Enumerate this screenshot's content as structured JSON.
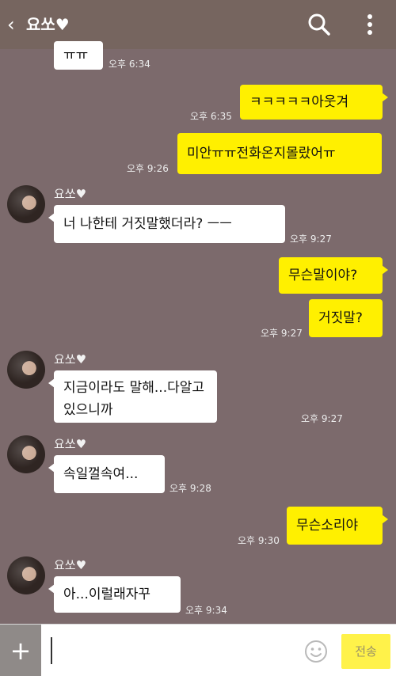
{
  "header": {
    "back_icon": "chevron-left-icon",
    "title": "요쏘♥",
    "search_icon": "search-icon",
    "more_icon": "more-vertical-icon"
  },
  "messages": [
    {
      "direction": "in",
      "text": "ㅠㅠ",
      "time": "오후 6:34"
    },
    {
      "direction": "out",
      "text": "ㅋㅋㅋㅋㅋ아웃겨",
      "time": "오후 6:35"
    },
    {
      "direction": "out",
      "text": "미안ㅠㅠ전화온지몰랐어ㅠ",
      "time": "오후 9:26"
    },
    {
      "direction": "in",
      "sender": "요쏘♥",
      "text": "너 나한테 거짓말했더라? ㅡㅡ",
      "time": "오후 9:27"
    },
    {
      "direction": "out",
      "text": "무슨말이야?",
      "time": ""
    },
    {
      "direction": "out",
      "text": "거짓말?",
      "time": "오후 9:27"
    },
    {
      "direction": "in",
      "sender": "요쏘♥",
      "text": "지금이라도 말해...다알고있으니까",
      "time": "오후 9:27"
    },
    {
      "direction": "in",
      "sender": "요쏘♥",
      "text": "속일껄속여...",
      "time": "오후 9:28"
    },
    {
      "direction": "out",
      "text": "무슨소리야",
      "time": "오후 9:30"
    },
    {
      "direction": "in",
      "sender": "요쏘♥",
      "text": "아...이럴래자꾸",
      "time": "오후 9:34"
    }
  ],
  "input_bar": {
    "plus_label": "+",
    "emoji_icon": "smiley-icon",
    "send_label": "전송"
  },
  "colors": {
    "background": "#7c6a6c",
    "header": "#76655f",
    "my_bubble": "#fff000",
    "their_bubble": "#ffffff",
    "send_button": "#fff24a"
  }
}
